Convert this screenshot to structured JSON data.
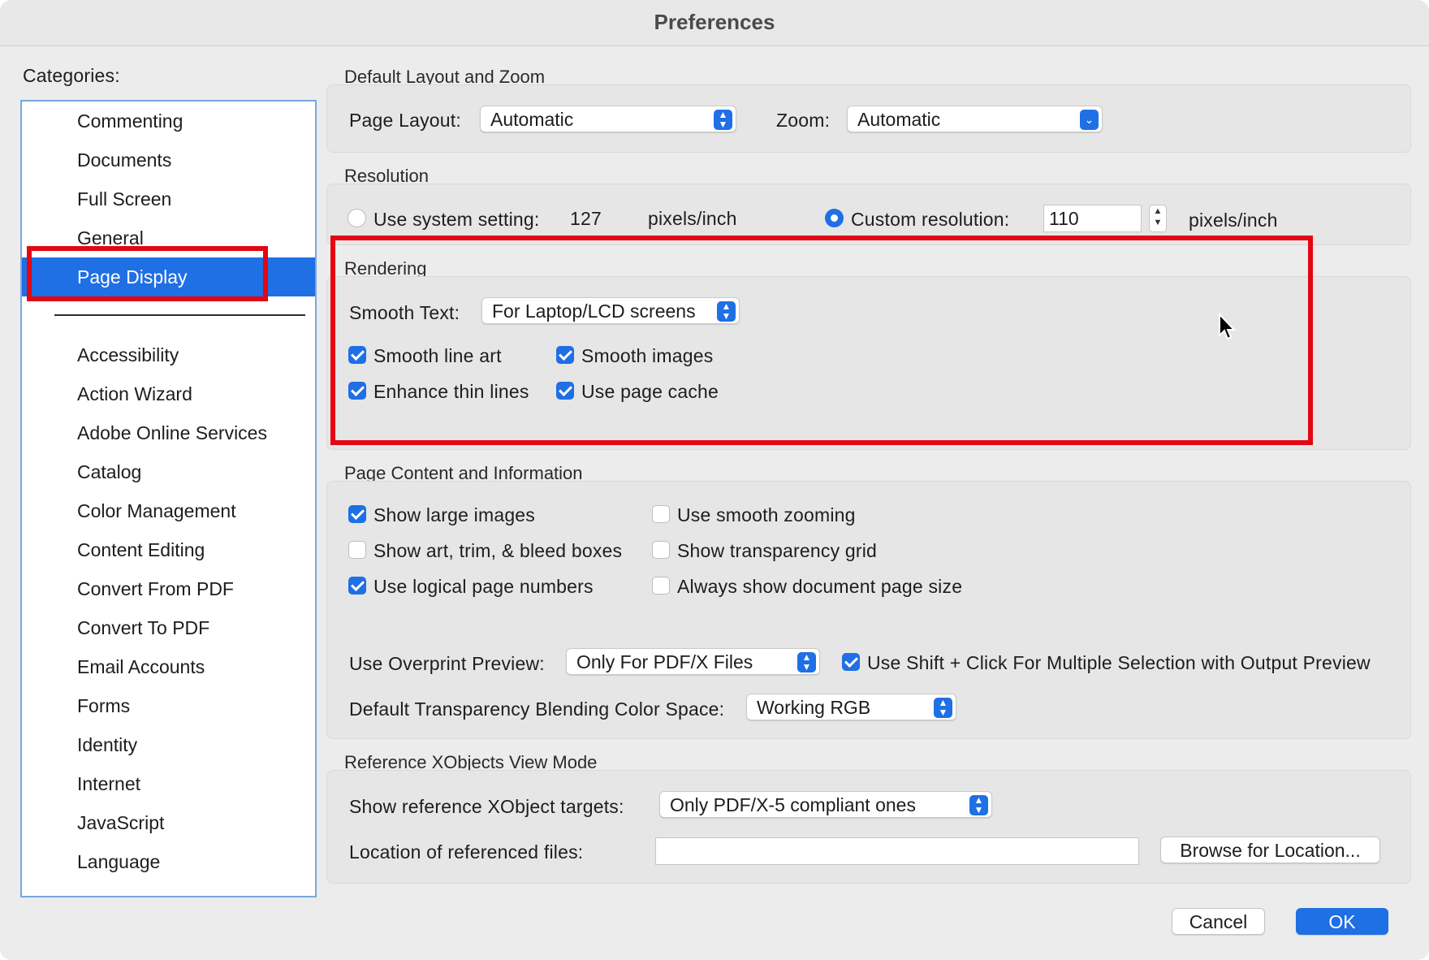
{
  "window": {
    "title": "Preferences"
  },
  "sidebar": {
    "heading": "Categories:",
    "items_top": [
      "Commenting",
      "Documents",
      "Full Screen",
      "General",
      "Page Display"
    ],
    "selected": "Page Display",
    "items_bottom": [
      "Accessibility",
      "Action Wizard",
      "Adobe Online Services",
      "Catalog",
      "Color Management",
      "Content Editing",
      "Convert From PDF",
      "Convert To PDF",
      "Email Accounts",
      "Forms",
      "Identity",
      "Internet",
      "JavaScript",
      "Language"
    ]
  },
  "layout_zoom": {
    "title": "Default Layout and Zoom",
    "page_layout_label": "Page Layout:",
    "page_layout_value": "Automatic",
    "zoom_label": "Zoom:",
    "zoom_value": "Automatic"
  },
  "resolution": {
    "title": "Resolution",
    "system_label": "Use system setting:",
    "system_value": "127",
    "system_unit": "pixels/inch",
    "custom_label": "Custom resolution:",
    "custom_value": "110",
    "custom_unit": "pixels/inch",
    "selected": "custom"
  },
  "rendering": {
    "title": "Rendering",
    "smooth_text_label": "Smooth Text:",
    "smooth_text_value": "For Laptop/LCD screens",
    "smooth_line_art": {
      "label": "Smooth line art",
      "checked": true
    },
    "smooth_images": {
      "label": "Smooth images",
      "checked": true
    },
    "enhance_thin_lines": {
      "label": "Enhance thin lines",
      "checked": true
    },
    "use_page_cache": {
      "label": "Use page cache",
      "checked": true
    }
  },
  "page_content": {
    "title": "Page Content and Information",
    "show_large_images": {
      "label": "Show large images",
      "checked": true
    },
    "use_smooth_zooming": {
      "label": "Use smooth zooming",
      "checked": false
    },
    "show_boxes": {
      "label": "Show art, trim, & bleed boxes",
      "checked": false
    },
    "show_transparency_grid": {
      "label": "Show transparency grid",
      "checked": false
    },
    "use_logical_page_numbers": {
      "label": "Use logical page numbers",
      "checked": true
    },
    "always_show_page_size": {
      "label": "Always show document page size",
      "checked": false
    },
    "overprint_label": "Use Overprint Preview:",
    "overprint_value": "Only For PDF/X Files",
    "shift_click": {
      "label": "Use Shift + Click For Multiple Selection with Output Preview",
      "checked": true
    },
    "blending_label": "Default Transparency Blending Color Space:",
    "blending_value": "Working RGB"
  },
  "xobjects": {
    "title": "Reference XObjects View Mode",
    "targets_label": "Show reference XObject targets:",
    "targets_value": "Only PDF/X-5 compliant ones",
    "location_label": "Location of referenced files:",
    "location_value": "",
    "browse_label": "Browse for Location..."
  },
  "footer": {
    "cancel_label": "Cancel",
    "ok_label": "OK"
  },
  "colors": {
    "accent": "#1f6fe5",
    "highlight": "#e30613"
  }
}
